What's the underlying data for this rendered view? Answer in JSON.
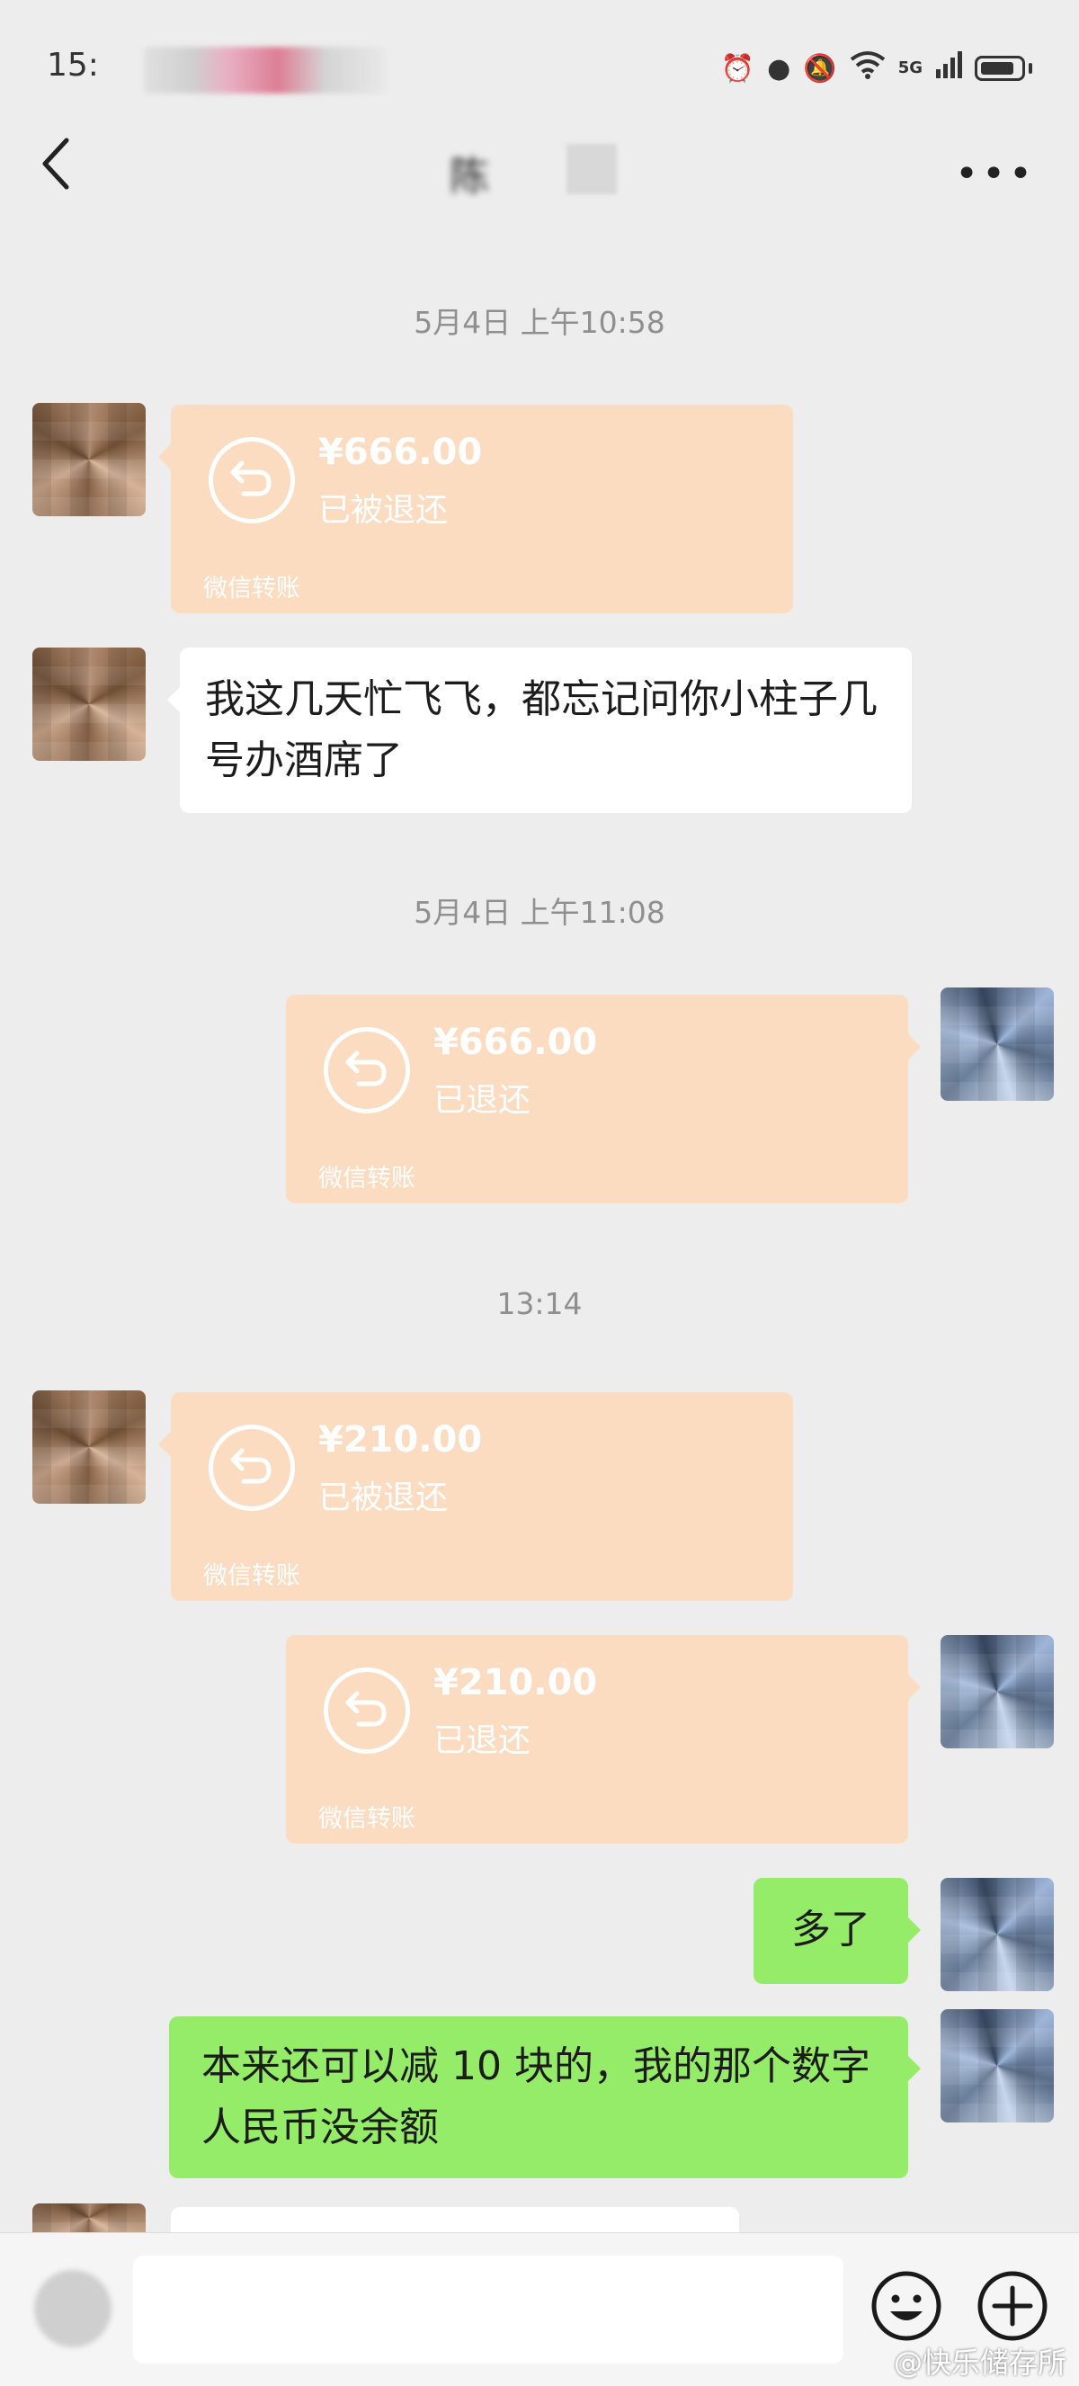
{
  "status_bar": {
    "time": "15:",
    "network": "5G"
  },
  "header": {
    "title": "陈"
  },
  "messages": {
    "ts1": "5月4日 上午10:58",
    "t1": {
      "amount": "¥666.00",
      "status": "已被退还",
      "caption": "微信转账"
    },
    "text1": "我这几天忙飞飞，都忘记问你小柱子几号办酒席了",
    "ts2": "5月4日 上午11:08",
    "t2": {
      "amount": "¥666.00",
      "status": "已退还",
      "caption": "微信转账"
    },
    "ts3": "13:14",
    "t3": {
      "amount": "¥210.00",
      "status": "已被退还",
      "caption": "微信转账"
    },
    "t4": {
      "amount": "¥210.00",
      "status": "已退还",
      "caption": "微信转账"
    },
    "text2": "多了",
    "text3": "本来还可以减 10 块的，我的那个数字人民币没余额"
  },
  "input_bar": {
    "placeholder": ""
  },
  "watermark": "@快乐储存所",
  "colors": {
    "background": "#ededed",
    "transfer_card": "#fbdcc1",
    "green_bubble": "#95ec69",
    "white_bubble": "#ffffff"
  },
  "icons": [
    "back-icon",
    "more-icon",
    "refund-icon",
    "emoji-icon",
    "plus-icon",
    "voice-icon"
  ]
}
